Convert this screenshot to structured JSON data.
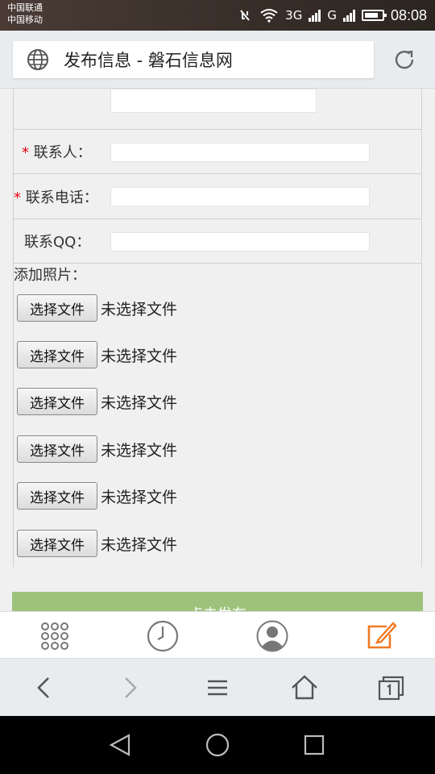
{
  "status_bar": {
    "carrier1": "中国联通",
    "carrier2": "中国移动",
    "net1": "3G",
    "net2": "G",
    "time": "08:08"
  },
  "address_bar": {
    "title": "发布信息 - 磐石信息网"
  },
  "form": {
    "contact_label": "联系人：",
    "phone_label": "联系电话：",
    "qq_label": "联系QQ：",
    "required_mark": "*",
    "photos_label": "添加照片：",
    "file_inputs": [
      {
        "button": "选择文件",
        "status": "未选择文件"
      },
      {
        "button": "选择文件",
        "status": "未选择文件"
      },
      {
        "button": "选择文件",
        "status": "未选择文件"
      },
      {
        "button": "选择文件",
        "status": "未选择文件"
      },
      {
        "button": "选择文件",
        "status": "未选择文件"
      },
      {
        "button": "选择文件",
        "status": "未选择文件"
      }
    ],
    "submit_label": "点击发布"
  },
  "colors": {
    "submit_green": "#9dc27b",
    "required_red": "#e60012",
    "edit_orange": "#f07a23"
  },
  "icons": {
    "toolbar": [
      "apps-grid-icon",
      "history-clock-icon",
      "user-avatar-icon",
      "edit-icon"
    ],
    "browser_nav": [
      "back-icon",
      "forward-icon",
      "menu-icon",
      "home-icon",
      "tabs-icon"
    ],
    "android_nav": [
      "back-triangle-icon",
      "home-circle-icon",
      "recents-square-icon"
    ]
  }
}
